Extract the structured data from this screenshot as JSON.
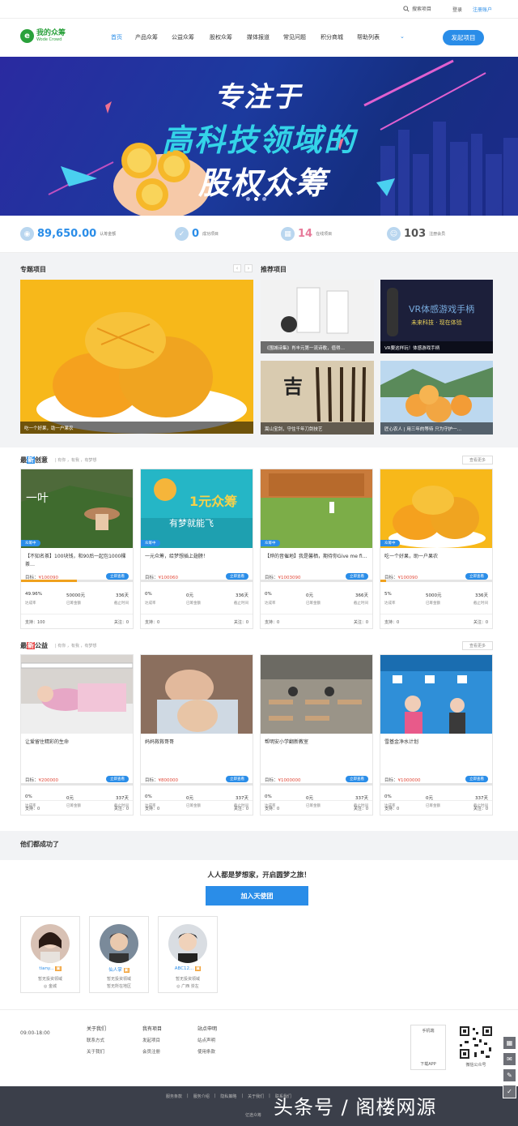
{
  "top": {
    "search": "搜索项目",
    "login": "登录",
    "register": "注册账户"
  },
  "logo": {
    "name": "我的众筹",
    "en": "Wode Crowd"
  },
  "nav": [
    "首页",
    "产品众筹",
    "公益众筹",
    "股权众筹",
    "媒体报道",
    "常见问题",
    "积分商城",
    "帮助列表"
  ],
  "start_button": "发起项目",
  "banner": {
    "line1": "专注于",
    "line2": "高科技领域的",
    "line3": "股权众筹"
  },
  "stats": [
    {
      "value": "89,650.00",
      "label": "认筹金额"
    },
    {
      "value": "0",
      "label": "成功项目"
    },
    {
      "value": "14",
      "label": "在线项目"
    },
    {
      "value": "103",
      "label": "注册会员"
    }
  ],
  "special": {
    "title": "专题项目",
    "caption": "吃一个好果，助一户果农"
  },
  "recommend": {
    "title": "推荐项目",
    "items": [
      "《围城诗集》肖丰元第一流诗歌，值得…",
      "VR要这样玩！体感游戏手柄",
      "嵩山宝剑，守住千年刀剑技艺",
      "匠心农人 | 用三年的等待 只为守护一…"
    ]
  },
  "creative": {
    "title_a": "最",
    "title_b": "新",
    "title_c": "创意",
    "hint": "| 有你 ，有我 ，有梦想",
    "more": "查看更多",
    "cards": [
      {
        "tag": "众筹中",
        "title": "【不知名茶】100块钱，和90后一起包1000棵茶…",
        "goal_label": "目标：",
        "goal": "¥100090",
        "btn": "立即查看",
        "pct": "49.96%",
        "pct_label": "达成率",
        "raised": "50000元",
        "raised_label": "已筹金额",
        "days": "336天",
        "days_label": "截止时间",
        "support": "支持：100",
        "follow": "关注：0",
        "fill": 0.5
      },
      {
        "tag": "众筹中",
        "title": "一元众筹，给梦想插上翅膀！",
        "goal_label": "目标：",
        "goal": "¥100060",
        "btn": "立即查看",
        "pct": "0%",
        "pct_label": "达成率",
        "raised": "0元",
        "raised_label": "已筹金额",
        "days": "336天",
        "days_label": "截止时间",
        "support": "支持：0",
        "follow": "关注：0",
        "fill": 0
      },
      {
        "tag": "众筹中",
        "title": "【烨的音催地】我是馨栖，期待你Give me fi…",
        "goal_label": "目标：",
        "goal": "¥1003090",
        "btn": "立即查看",
        "pct": "0%",
        "pct_label": "达成率",
        "raised": "0元",
        "raised_label": "已筹金额",
        "days": "366天",
        "days_label": "截止时间",
        "support": "支持：0",
        "follow": "关注：0",
        "fill": 0
      },
      {
        "tag": "众筹中",
        "title": "吃一个好果，助一户果农",
        "goal_label": "目标：",
        "goal": "¥100090",
        "btn": "立即查看",
        "pct": "5%",
        "pct_label": "达成率",
        "raised": "5000元",
        "raised_label": "已筹金额",
        "days": "336天",
        "days_label": "截止时间",
        "support": "支持：0",
        "follow": "关注：0",
        "fill": 0.05
      }
    ]
  },
  "charity": {
    "title_a": "最",
    "title_b": "新",
    "title_c": "公益",
    "hint": "| 有你 ，有我 ，有梦想",
    "more": "查看更多",
    "cards": [
      {
        "title": "让爱留住精彩的生命",
        "goal_label": "目标：",
        "goal": "¥200000",
        "btn": "立即查看",
        "pct": "0%",
        "pct_label": "达成率",
        "raised": "0元",
        "raised_label": "已筹金额",
        "days": "337天",
        "days_label": "截止时间",
        "support": "支持：0",
        "follow": "关注：0"
      },
      {
        "title": "妈妈救救哥哥",
        "goal_label": "目标：",
        "goal": "¥800000",
        "btn": "立即查看",
        "pct": "0%",
        "pct_label": "达成率",
        "raised": "0元",
        "raised_label": "已筹金额",
        "days": "337天",
        "days_label": "截止时间",
        "support": "支持：0",
        "follow": "关注：0"
      },
      {
        "title": "帮明安小学翻新教室",
        "goal_label": "目标：",
        "goal": "¥1000000",
        "btn": "立即查看",
        "pct": "0%",
        "pct_label": "达成率",
        "raised": "0元",
        "raised_label": "已筹金额",
        "days": "337天",
        "days_label": "截止时间",
        "support": "支持：0",
        "follow": "关注：0"
      },
      {
        "title": "雪基金净水计划",
        "goal_label": "目标：",
        "goal": "¥1000000",
        "btn": "立即查看",
        "pct": "0%",
        "pct_label": "达成率",
        "raised": "0元",
        "raised_label": "已筹金额",
        "days": "337天",
        "days_label": "截止时间",
        "support": "支持：0",
        "follow": "关注：0"
      }
    ]
  },
  "success": {
    "title": "他们都成功了",
    "slogan": "人人都是梦想家，开启圆梦之旅！",
    "join": "加入天使团",
    "angels": [
      {
        "name": "tiany...",
        "desc": "暂无投资领域",
        "loc": "◎ 金城"
      },
      {
        "name": "仙人掌",
        "desc": "暂无投资领域",
        "loc": "暂无所在地区"
      },
      {
        "name": "ABC12...",
        "desc": "暂无投资领域",
        "loc": "◎ 广西 崇左"
      }
    ]
  },
  "footer": {
    "hours": "09:00-18:00",
    "col1": {
      "head": "关于我们",
      "items": [
        "联系方式",
        "关于我们"
      ]
    },
    "col2": {
      "head": "我有项目",
      "items": [
        "发起项目",
        "会员注册"
      ]
    },
    "col3": {
      "head": "站点申明",
      "items": [
        "站点声明",
        "使用条款"
      ]
    },
    "app_label": "手机端",
    "app_download": "下载APP",
    "wechat": "微信公众号"
  },
  "bottom": {
    "links": [
      "服务条款",
      "|",
      "服务介绍",
      "|",
      "隐私策略",
      "|",
      "关于我们",
      "|",
      "联系我们"
    ],
    "copyright": "亿途众筹"
  },
  "watermark": "头条号 / 阁楼网源"
}
